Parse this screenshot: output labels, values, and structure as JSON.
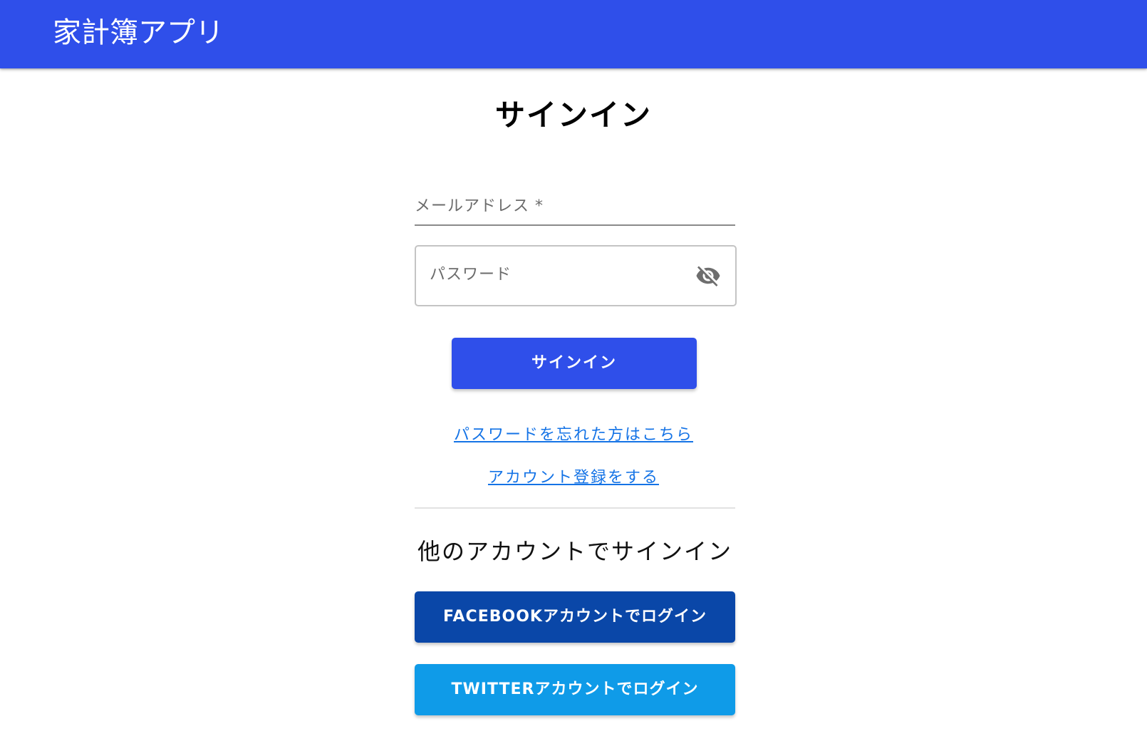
{
  "app": {
    "title": "家計簿アプリ",
    "accent_color": "#2f4fea"
  },
  "page": {
    "title": "サインイン"
  },
  "form": {
    "email_label": "メールアドレス *",
    "email_value": "",
    "password_label": "パスワード",
    "password_value": "",
    "password_toggle_icon": "visibility-off-icon",
    "submit_label": "サインイン"
  },
  "links": {
    "forgot_password": "パスワードを忘れた方はこちら",
    "register": "アカウント登録をする"
  },
  "social": {
    "heading": "他のアカウントでサインイン",
    "facebook_label": "FACEBOOKアカウントでログイン",
    "facebook_color": "#0a47a8",
    "twitter_label": "TWITTERアカウントでログイン",
    "twitter_color": "#0f9be8"
  }
}
